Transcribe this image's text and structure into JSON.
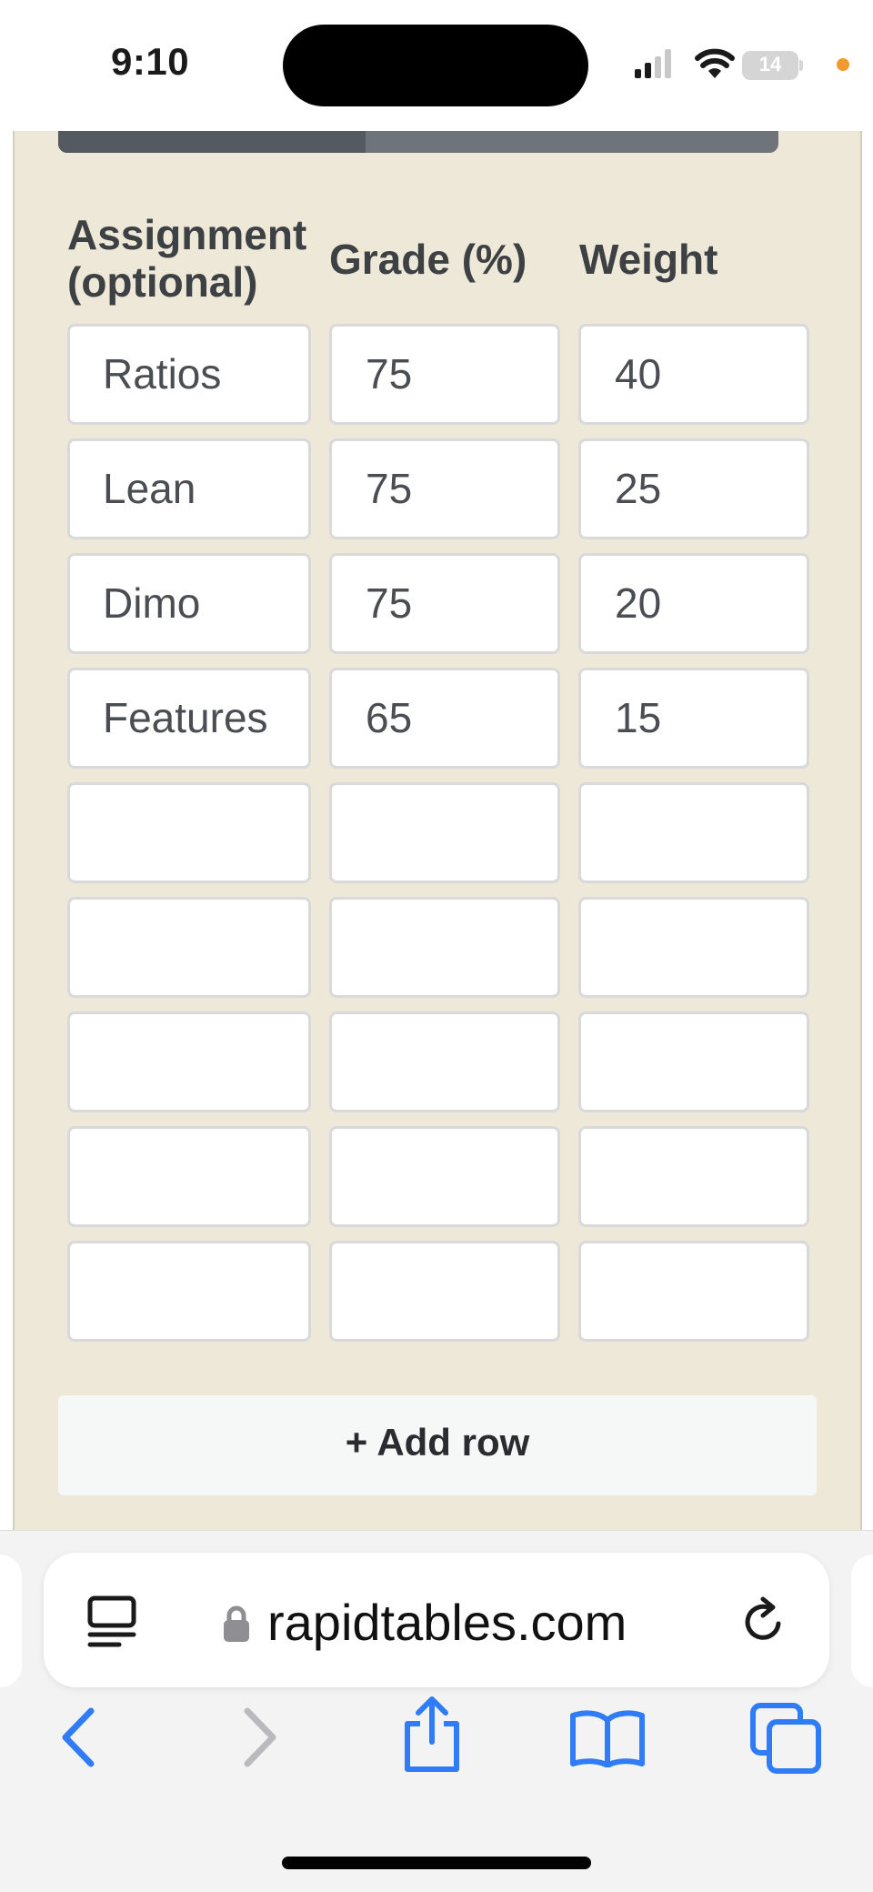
{
  "status_bar": {
    "time": "9:10",
    "battery": "14"
  },
  "page": {
    "table": {
      "headers": {
        "assignment": "Assignment\n(optional)",
        "grade": "Grade (%)",
        "weight": "Weight"
      },
      "rows": [
        {
          "assignment": "Ratios",
          "grade": "75",
          "weight": "40"
        },
        {
          "assignment": "Lean",
          "grade": "75",
          "weight": "25"
        },
        {
          "assignment": "Dimo",
          "grade": "75",
          "weight": "20"
        },
        {
          "assignment": "Features",
          "grade": "65",
          "weight": "15"
        },
        {
          "assignment": "",
          "grade": "",
          "weight": ""
        },
        {
          "assignment": "",
          "grade": "",
          "weight": ""
        },
        {
          "assignment": "",
          "grade": "",
          "weight": ""
        },
        {
          "assignment": "",
          "grade": "",
          "weight": ""
        },
        {
          "assignment": "",
          "grade": "",
          "weight": ""
        }
      ]
    },
    "add_row_label": "+ Add row"
  },
  "browser": {
    "url": "rapidtables.com",
    "icons": [
      "reader-icon",
      "lock-icon",
      "reload-icon",
      "back-icon",
      "forward-icon",
      "share-icon",
      "bookmarks-icon",
      "tabs-icon"
    ]
  },
  "colors": {
    "page_background": "#ede8d8",
    "accent_blue": "#2f7cf6",
    "status_dot": "#f29a2e"
  }
}
